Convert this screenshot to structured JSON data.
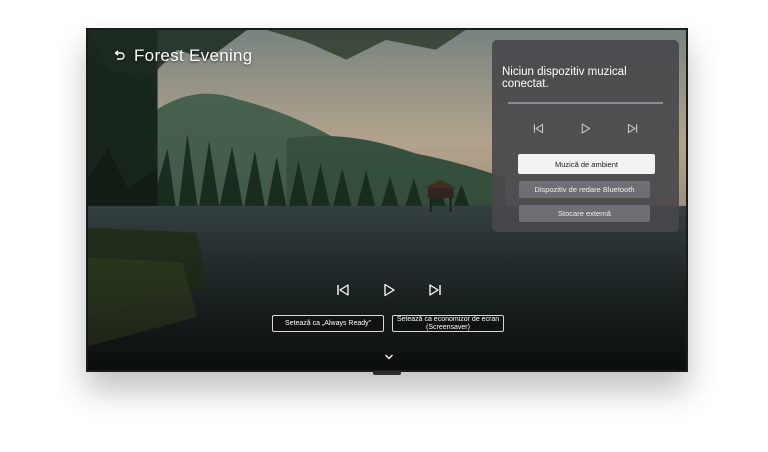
{
  "screen": {
    "title": "Forest Evening",
    "controls": {
      "prev": "previous-track",
      "play": "play",
      "next": "next-track"
    },
    "options": [
      "Setează ca „Always Ready”",
      "Setează ca economizor de ecran (Screensaver)"
    ]
  },
  "music_panel": {
    "title": "Niciun dispozitiv muzical conectat.",
    "items": [
      {
        "label": "Muzică de ambient",
        "selected": true
      },
      {
        "label": "Dispozitiv de redare Bluetooth",
        "selected": false
      },
      {
        "label": "Stocare externă",
        "selected": false
      }
    ]
  },
  "colors": {
    "panel_bg": "#48484c",
    "selected_item": "#f2f2f2",
    "idle_item": "#6e6e74",
    "text": "#ffffff"
  }
}
